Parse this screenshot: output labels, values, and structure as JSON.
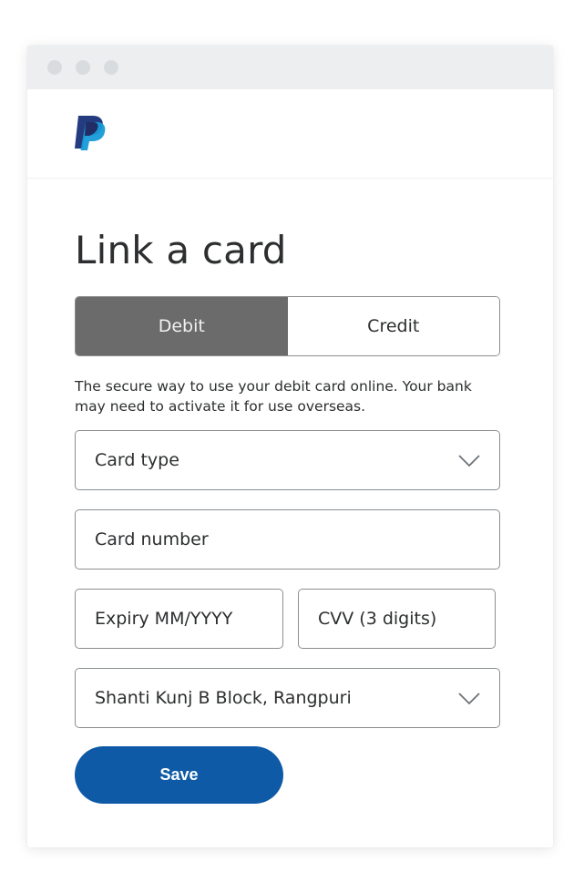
{
  "brand": {
    "logo_icon": "paypal-logo",
    "colors": {
      "dark_blue": "#253b80",
      "light_blue": "#179bd7",
      "button": "#0e5aa7"
    }
  },
  "page": {
    "title": "Link a card"
  },
  "card_kind_toggle": {
    "options": [
      {
        "label": "Debit",
        "selected": true
      },
      {
        "label": "Credit",
        "selected": false
      }
    ]
  },
  "description": "The secure way to use your debit card online. Your bank may need to activate it for use overseas.",
  "form": {
    "card_type": {
      "placeholder": "Card type",
      "icon": "chevron-down-icon"
    },
    "card_number": {
      "placeholder": "Card number"
    },
    "expiry": {
      "placeholder": "Expiry MM/YYYY"
    },
    "cvv": {
      "placeholder": "CVV (3 digits)"
    },
    "billing_address": {
      "value": "Shanti Kunj B Block, Rangpuri",
      "icon": "chevron-down-icon"
    }
  },
  "actions": {
    "save_label": "Save"
  }
}
